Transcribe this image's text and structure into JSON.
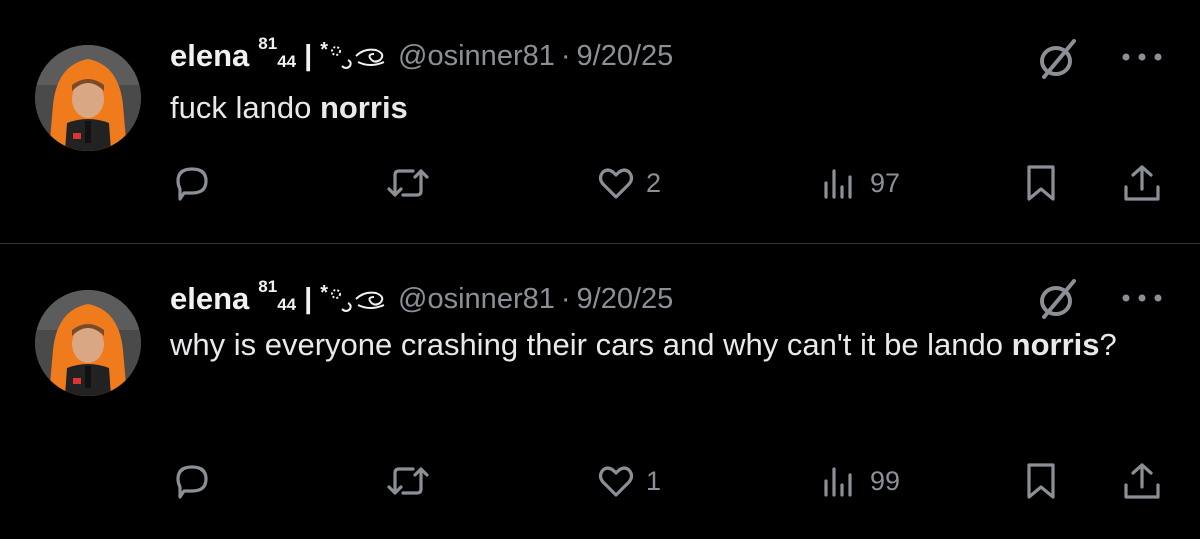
{
  "tweets": [
    {
      "author": {
        "name": "elena",
        "name_sup": "81",
        "name_sub": "44",
        "name_bar": "|",
        "name_star": "*",
        "handle": "@osinner81",
        "separator": "·",
        "date": "9/20/25"
      },
      "text_parts": [
        {
          "text": "fuck lando ",
          "bold": false
        },
        {
          "text": "norris",
          "bold": true
        }
      ],
      "metrics": {
        "replies": "",
        "reposts": "",
        "likes": "2",
        "views": "97"
      }
    },
    {
      "author": {
        "name": "elena",
        "name_sup": "81",
        "name_sub": "44",
        "name_bar": "|",
        "name_star": "*",
        "handle": "@osinner81",
        "separator": "·",
        "date": "9/20/25"
      },
      "text_parts": [
        {
          "text": "why is everyone crashing their cars and why can't it be lando ",
          "bold": false
        },
        {
          "text": "norris",
          "bold": true
        },
        {
          "text": "?",
          "bold": false
        }
      ],
      "metrics": {
        "replies": "",
        "reposts": "",
        "likes": "1",
        "views": "99"
      }
    }
  ],
  "icons": [
    "reply-icon",
    "repost-icon",
    "like-icon",
    "views-icon",
    "bookmark-icon",
    "share-icon",
    "verified-icon",
    "more-icon"
  ],
  "colors": {
    "background": "#000000",
    "text": "#e7e9ea",
    "muted": "#8b9096",
    "avatar_accent": "#f07b1d"
  }
}
